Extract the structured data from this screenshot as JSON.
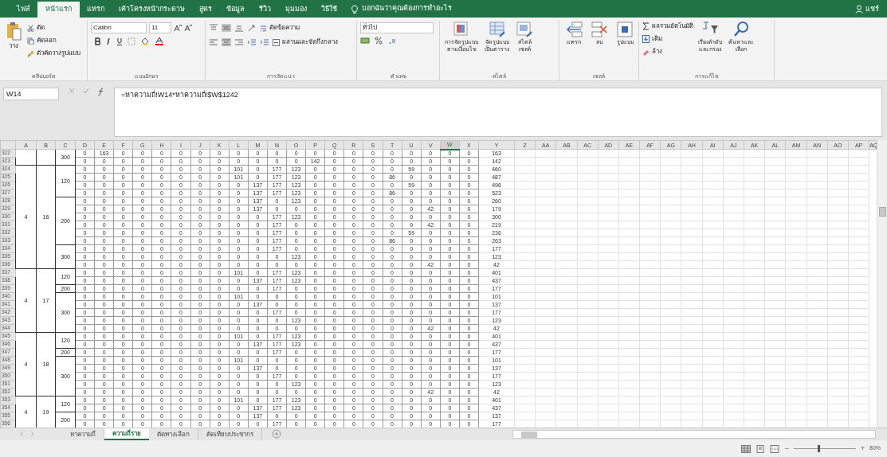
{
  "title_bar": {
    "tabs": [
      {
        "label": "ไฟล์",
        "selected": false
      },
      {
        "label": "หน้าแรก",
        "selected": true
      },
      {
        "label": "แทรก",
        "selected": false
      },
      {
        "label": "เค้าโครงหน้ากระดาษ",
        "selected": false
      },
      {
        "label": "สูตร",
        "selected": false
      },
      {
        "label": "ข้อมูล",
        "selected": false
      },
      {
        "label": "รีวิว",
        "selected": false
      },
      {
        "label": "มุมมอง",
        "selected": false
      },
      {
        "label": "วิธีใช้",
        "selected": false
      }
    ],
    "tell_me": "บอกฉันว่าคุณต้องการทำอะไร",
    "share": "แชร์"
  },
  "ribbon": {
    "clipboard": {
      "paste": "วาง",
      "cut": "ตัด",
      "copy": "คัดลอก",
      "format_painter": "ตัวคัดวางรูปแบบ",
      "label": "คลิปบอร์ด"
    },
    "font": {
      "font_name": "Calibri",
      "font_size": "11",
      "label": "แบบอักษร"
    },
    "alignment": {
      "wrap_text": "ตัดข้อความ",
      "merge_center": "ผสานและจัดกึ่งกลาง",
      "label": "การจัดแนว"
    },
    "number": {
      "format": "ทั่วไป",
      "label": "ตัวเลข"
    },
    "styles": {
      "buttons": [
        [
          "การจัดรูปแบบ",
          "ตามเงื่อนไข"
        ],
        [
          "จัดรูปแบบ",
          "เป็นตาราง"
        ],
        [
          "สไตล์",
          "เซลล์"
        ]
      ],
      "label": "สไตล์"
    },
    "cells": {
      "buttons": [
        "แทรก",
        "ลบ",
        "รูปแบบ"
      ],
      "label": "เซลล์"
    },
    "editing": {
      "autosum": "ผลรวมอัตโนมัติ",
      "fill": "เติม",
      "clear": "ล้าง",
      "sort_filter": [
        "เรียงลำดับ",
        "และกรอง"
      ],
      "find_select": [
        "ค้นหาและ",
        "เลือก"
      ],
      "label": "การแก้ไข"
    }
  },
  "formula_bar": {
    "name_box": "W14",
    "formula": "=หาความถี่!W14*หาความถี่!$W$1242"
  },
  "sheet": {
    "columns": [
      {
        "label": "A",
        "selected": false
      },
      {
        "label": "B",
        "selected": false
      },
      {
        "label": "C",
        "selected": false
      },
      {
        "label": "D",
        "selected": false
      },
      {
        "label": "E",
        "selected": false
      },
      {
        "label": "F",
        "selected": false
      },
      {
        "label": "G",
        "selected": false
      },
      {
        "label": "H",
        "selected": false
      },
      {
        "label": "I",
        "selected": false
      },
      {
        "label": "J",
        "selected": false
      },
      {
        "label": "K",
        "selected": false
      },
      {
        "label": "L",
        "selected": false
      },
      {
        "label": "M",
        "selected": false
      },
      {
        "label": "N",
        "selected": false
      },
      {
        "label": "O",
        "selected": false
      },
      {
        "label": "P",
        "selected": false
      },
      {
        "label": "Q",
        "selected": false
      },
      {
        "label": "R",
        "selected": false
      },
      {
        "label": "S",
        "selected": false
      },
      {
        "label": "T",
        "selected": false
      },
      {
        "label": "U",
        "selected": false
      },
      {
        "label": "V",
        "selected": false
      },
      {
        "label": "W",
        "selected": true
      },
      {
        "label": "X",
        "selected": false
      },
      {
        "label": "Y",
        "selected": false
      },
      {
        "label": "Z",
        "selected": false
      },
      {
        "label": "AA",
        "selected": false
      },
      {
        "label": "AB",
        "selected": false
      },
      {
        "label": "AC",
        "selected": false
      },
      {
        "label": "AD",
        "selected": false
      },
      {
        "label": "AE",
        "selected": false
      },
      {
        "label": "AF",
        "selected": false
      },
      {
        "label": "AG",
        "selected": false
      },
      {
        "label": "AH",
        "selected": false
      },
      {
        "label": "AI",
        "selected": false
      },
      {
        "label": "AJ",
        "selected": false
      },
      {
        "label": "AK",
        "selected": false
      },
      {
        "label": "AL",
        "selected": false
      },
      {
        "label": "AM",
        "selected": false
      },
      {
        "label": "AN",
        "selected": false
      },
      {
        "label": "AO",
        "selected": false
      },
      {
        "label": "AP",
        "selected": false
      },
      {
        "label": "AQ",
        "selected": false
      }
    ],
    "blocks": [
      {
        "subgroups": [
          {
            "column_c": "300",
            "rows": [
              {
                "header": "322",
                "values": [
                  "0",
                  "163",
                  "0",
                  "0",
                  "0",
                  "0",
                  "0",
                  "0",
                  "0",
                  "0",
                  "0",
                  "0",
                  "0",
                  "0",
                  "0",
                  "0",
                  "0",
                  "0",
                  "0",
                  "0",
                  "0"
                ],
                "total": "163"
              },
              {
                "header": "323",
                "values": [
                  "0",
                  "0",
                  "0",
                  "0",
                  "0",
                  "0",
                  "0",
                  "0",
                  "0",
                  "0",
                  "0",
                  "0",
                  "142",
                  "0",
                  "0",
                  "0",
                  "0",
                  "0",
                  "0",
                  "0",
                  "0"
                ],
                "total": "142"
              }
            ]
          }
        ]
      },
      {
        "column_a": "4",
        "column_b": "16",
        "subgroups": [
          {
            "column_c": "120",
            "rows": [
              {
                "header": "324",
                "values": [
                  "0",
                  "0",
                  "0",
                  "0",
                  "0",
                  "0",
                  "0",
                  "0",
                  "101",
                  "0",
                  "177",
                  "123",
                  "0",
                  "0",
                  "0",
                  "0",
                  "0",
                  "59",
                  "0",
                  "0",
                  "0"
                ],
                "total": "460"
              },
              {
                "header": "325",
                "values": [
                  "0",
                  "0",
                  "0",
                  "0",
                  "0",
                  "0",
                  "0",
                  "0",
                  "101",
                  "0",
                  "177",
                  "123",
                  "0",
                  "0",
                  "0",
                  "0",
                  "86",
                  "0",
                  "0",
                  "0",
                  "0"
                ],
                "total": "487"
              },
              {
                "header": "326",
                "values": [
                  "0",
                  "0",
                  "0",
                  "0",
                  "0",
                  "0",
                  "0",
                  "0",
                  "0",
                  "137",
                  "177",
                  "123",
                  "0",
                  "0",
                  "0",
                  "0",
                  "0",
                  "59",
                  "0",
                  "0",
                  "0"
                ],
                "total": "496"
              },
              {
                "header": "327",
                "values": [
                  "0",
                  "0",
                  "0",
                  "0",
                  "0",
                  "0",
                  "0",
                  "0",
                  "0",
                  "137",
                  "177",
                  "123",
                  "0",
                  "0",
                  "0",
                  "0",
                  "86",
                  "0",
                  "0",
                  "0",
                  "0"
                ],
                "total": "523"
              }
            ]
          },
          {
            "column_c": "200",
            "rows": [
              {
                "header": "328",
                "values": [
                  "0",
                  "0",
                  "0",
                  "0",
                  "0",
                  "0",
                  "0",
                  "0",
                  "0",
                  "137",
                  "0",
                  "123",
                  "0",
                  "0",
                  "0",
                  "0",
                  "0",
                  "0",
                  "0",
                  "0",
                  "0"
                ],
                "total": "260"
              },
              {
                "header": "329",
                "values": [
                  "0",
                  "0",
                  "0",
                  "0",
                  "0",
                  "0",
                  "0",
                  "0",
                  "0",
                  "137",
                  "0",
                  "0",
                  "0",
                  "0",
                  "0",
                  "0",
                  "0",
                  "0",
                  "42",
                  "0",
                  "0"
                ],
                "total": "179"
              },
              {
                "header": "330",
                "values": [
                  "0",
                  "0",
                  "0",
                  "0",
                  "0",
                  "0",
                  "0",
                  "0",
                  "0",
                  "0",
                  "177",
                  "123",
                  "0",
                  "0",
                  "0",
                  "0",
                  "0",
                  "0",
                  "0",
                  "0",
                  "0"
                ],
                "total": "300"
              },
              {
                "header": "331",
                "values": [
                  "0",
                  "0",
                  "0",
                  "0",
                  "0",
                  "0",
                  "0",
                  "0",
                  "0",
                  "0",
                  "177",
                  "0",
                  "0",
                  "0",
                  "0",
                  "0",
                  "0",
                  "0",
                  "42",
                  "0",
                  "0"
                ],
                "total": "219"
              },
              {
                "header": "332",
                "values": [
                  "0",
                  "0",
                  "0",
                  "0",
                  "0",
                  "0",
                  "0",
                  "0",
                  "0",
                  "0",
                  "177",
                  "0",
                  "0",
                  "0",
                  "0",
                  "0",
                  "0",
                  "59",
                  "0",
                  "0",
                  "0"
                ],
                "total": "236"
              },
              {
                "header": "333",
                "values": [
                  "0",
                  "0",
                  "0",
                  "0",
                  "0",
                  "0",
                  "0",
                  "0",
                  "0",
                  "0",
                  "177",
                  "0",
                  "0",
                  "0",
                  "0",
                  "0",
                  "86",
                  "0",
                  "0",
                  "0",
                  "0"
                ],
                "total": "263"
              }
            ]
          },
          {
            "column_c": "300",
            "rows": [
              {
                "header": "334",
                "values": [
                  "0",
                  "0",
                  "0",
                  "0",
                  "0",
                  "0",
                  "0",
                  "0",
                  "0",
                  "0",
                  "177",
                  "0",
                  "0",
                  "0",
                  "0",
                  "0",
                  "0",
                  "0",
                  "0",
                  "0",
                  "0"
                ],
                "total": "177"
              },
              {
                "header": "335",
                "values": [
                  "0",
                  "0",
                  "0",
                  "0",
                  "0",
                  "0",
                  "0",
                  "0",
                  "0",
                  "0",
                  "0",
                  "123",
                  "0",
                  "0",
                  "0",
                  "0",
                  "0",
                  "0",
                  "0",
                  "0",
                  "0"
                ],
                "total": "123"
              },
              {
                "header": "336",
                "values": [
                  "0",
                  "0",
                  "0",
                  "0",
                  "0",
                  "0",
                  "0",
                  "0",
                  "0",
                  "0",
                  "0",
                  "0",
                  "0",
                  "0",
                  "0",
                  "0",
                  "0",
                  "0",
                  "42",
                  "0",
                  "0"
                ],
                "total": "42"
              }
            ]
          }
        ]
      },
      {
        "column_a": "4",
        "column_b": "17",
        "subgroups": [
          {
            "column_c": "120",
            "rows": [
              {
                "header": "337",
                "values": [
                  "0",
                  "0",
                  "0",
                  "0",
                  "0",
                  "0",
                  "0",
                  "0",
                  "101",
                  "0",
                  "177",
                  "123",
                  "0",
                  "0",
                  "0",
                  "0",
                  "0",
                  "0",
                  "0",
                  "0",
                  "0"
                ],
                "total": "401"
              },
              {
                "header": "338",
                "values": [
                  "0",
                  "0",
                  "0",
                  "0",
                  "0",
                  "0",
                  "0",
                  "0",
                  "0",
                  "137",
                  "177",
                  "123",
                  "0",
                  "0",
                  "0",
                  "0",
                  "0",
                  "0",
                  "0",
                  "0",
                  "0"
                ],
                "total": "437"
              }
            ]
          },
          {
            "column_c": "200",
            "rows": [
              {
                "header": "339",
                "values": [
                  "0",
                  "0",
                  "0",
                  "0",
                  "0",
                  "0",
                  "0",
                  "0",
                  "0",
                  "0",
                  "177",
                  "0",
                  "0",
                  "0",
                  "0",
                  "0",
                  "0",
                  "0",
                  "0",
                  "0",
                  "0"
                ],
                "total": "177"
              }
            ]
          },
          {
            "column_c": "300",
            "rows": [
              {
                "header": "340",
                "values": [
                  "0",
                  "0",
                  "0",
                  "0",
                  "0",
                  "0",
                  "0",
                  "0",
                  "101",
                  "0",
                  "0",
                  "0",
                  "0",
                  "0",
                  "0",
                  "0",
                  "0",
                  "0",
                  "0",
                  "0",
                  "0"
                ],
                "total": "101"
              },
              {
                "header": "341",
                "values": [
                  "0",
                  "0",
                  "0",
                  "0",
                  "0",
                  "0",
                  "0",
                  "0",
                  "0",
                  "137",
                  "0",
                  "0",
                  "0",
                  "0",
                  "0",
                  "0",
                  "0",
                  "0",
                  "0",
                  "0",
                  "0"
                ],
                "total": "137"
              },
              {
                "header": "342",
                "values": [
                  "0",
                  "0",
                  "0",
                  "0",
                  "0",
                  "0",
                  "0",
                  "0",
                  "0",
                  "0",
                  "177",
                  "0",
                  "0",
                  "0",
                  "0",
                  "0",
                  "0",
                  "0",
                  "0",
                  "0",
                  "0"
                ],
                "total": "177"
              },
              {
                "header": "343",
                "values": [
                  "0",
                  "0",
                  "0",
                  "0",
                  "0",
                  "0",
                  "0",
                  "0",
                  "0",
                  "0",
                  "0",
                  "123",
                  "0",
                  "0",
                  "0",
                  "0",
                  "0",
                  "0",
                  "0",
                  "0",
                  "0"
                ],
                "total": "123"
              },
              {
                "header": "344",
                "values": [
                  "0",
                  "0",
                  "0",
                  "0",
                  "0",
                  "0",
                  "0",
                  "0",
                  "0",
                  "0",
                  "0",
                  "0",
                  "0",
                  "0",
                  "0",
                  "0",
                  "0",
                  "0",
                  "42",
                  "0",
                  "0"
                ],
                "total": "42"
              }
            ]
          }
        ]
      },
      {
        "column_a": "4",
        "column_b": "18",
        "subgroups": [
          {
            "column_c": "120",
            "rows": [
              {
                "header": "345",
                "values": [
                  "0",
                  "0",
                  "0",
                  "0",
                  "0",
                  "0",
                  "0",
                  "0",
                  "101",
                  "0",
                  "177",
                  "123",
                  "0",
                  "0",
                  "0",
                  "0",
                  "0",
                  "0",
                  "0",
                  "0",
                  "0"
                ],
                "total": "401"
              },
              {
                "header": "346",
                "values": [
                  "0",
                  "0",
                  "0",
                  "0",
                  "0",
                  "0",
                  "0",
                  "0",
                  "0",
                  "137",
                  "177",
                  "123",
                  "0",
                  "0",
                  "0",
                  "0",
                  "0",
                  "0",
                  "0",
                  "0",
                  "0"
                ],
                "total": "437"
              }
            ]
          },
          {
            "column_c": "200",
            "rows": [
              {
                "header": "347",
                "values": [
                  "0",
                  "0",
                  "0",
                  "0",
                  "0",
                  "0",
                  "0",
                  "0",
                  "0",
                  "0",
                  "177",
                  "0",
                  "0",
                  "0",
                  "0",
                  "0",
                  "0",
                  "0",
                  "0",
                  "0",
                  "0"
                ],
                "total": "177"
              }
            ]
          },
          {
            "column_c": "300",
            "rows": [
              {
                "header": "348",
                "values": [
                  "0",
                  "0",
                  "0",
                  "0",
                  "0",
                  "0",
                  "0",
                  "0",
                  "101",
                  "0",
                  "0",
                  "0",
                  "0",
                  "0",
                  "0",
                  "0",
                  "0",
                  "0",
                  "0",
                  "0",
                  "0"
                ],
                "total": "101"
              },
              {
                "header": "349",
                "values": [
                  "0",
                  "0",
                  "0",
                  "0",
                  "0",
                  "0",
                  "0",
                  "0",
                  "0",
                  "137",
                  "0",
                  "0",
                  "0",
                  "0",
                  "0",
                  "0",
                  "0",
                  "0",
                  "0",
                  "0",
                  "0"
                ],
                "total": "137"
              },
              {
                "header": "350",
                "values": [
                  "0",
                  "0",
                  "0",
                  "0",
                  "0",
                  "0",
                  "0",
                  "0",
                  "0",
                  "0",
                  "177",
                  "0",
                  "0",
                  "0",
                  "0",
                  "0",
                  "0",
                  "0",
                  "0",
                  "0",
                  "0"
                ],
                "total": "177"
              },
              {
                "header": "351",
                "values": [
                  "0",
                  "0",
                  "0",
                  "0",
                  "0",
                  "0",
                  "0",
                  "0",
                  "0",
                  "0",
                  "0",
                  "123",
                  "0",
                  "0",
                  "0",
                  "0",
                  "0",
                  "0",
                  "0",
                  "0",
                  "0"
                ],
                "total": "123"
              },
              {
                "header": "352",
                "values": [
                  "0",
                  "0",
                  "0",
                  "0",
                  "0",
                  "0",
                  "0",
                  "0",
                  "0",
                  "0",
                  "0",
                  "0",
                  "0",
                  "0",
                  "0",
                  "0",
                  "0",
                  "0",
                  "42",
                  "0",
                  "0"
                ],
                "total": "42"
              }
            ]
          }
        ]
      },
      {
        "column_a": "4",
        "column_b": "19",
        "subgroups": [
          {
            "column_c": "120",
            "rows": [
              {
                "header": "353",
                "values": [
                  "0",
                  "0",
                  "0",
                  "0",
                  "0",
                  "0",
                  "0",
                  "0",
                  "101",
                  "0",
                  "177",
                  "123",
                  "0",
                  "0",
                  "0",
                  "0",
                  "0",
                  "0",
                  "0",
                  "0",
                  "0"
                ],
                "total": "401"
              },
              {
                "header": "354",
                "values": [
                  "0",
                  "0",
                  "0",
                  "0",
                  "0",
                  "0",
                  "0",
                  "0",
                  "0",
                  "137",
                  "177",
                  "123",
                  "0",
                  "0",
                  "0",
                  "0",
                  "0",
                  "0",
                  "0",
                  "0",
                  "0"
                ],
                "total": "437"
              }
            ]
          },
          {
            "column_c": "200",
            "rows": [
              {
                "header": "355",
                "values": [
                  "0",
                  "0",
                  "0",
                  "0",
                  "0",
                  "0",
                  "0",
                  "0",
                  "0",
                  "137",
                  "0",
                  "0",
                  "0",
                  "0",
                  "0",
                  "0",
                  "0",
                  "0",
                  "0",
                  "0",
                  "0"
                ],
                "total": "137"
              },
              {
                "header": "356",
                "values": [
                  "0",
                  "0",
                  "0",
                  "0",
                  "0",
                  "0",
                  "0",
                  "0",
                  "0",
                  "0",
                  "177",
                  "0",
                  "0",
                  "0",
                  "0",
                  "0",
                  "0",
                  "0",
                  "0",
                  "0",
                  "0"
                ],
                "total": "177"
              }
            ]
          }
        ]
      }
    ]
  },
  "sheet_tabs": [
    {
      "label": "หาความถี่",
      "selected": false
    },
    {
      "label": "ความถี่ราย",
      "selected": true
    },
    {
      "label": "ตัดทางเลือก",
      "selected": false
    },
    {
      "label": "ตัดเทียบประชากร",
      "selected": false
    }
  ],
  "status_bar": {
    "zoom_out": "−",
    "zoom_in": "+",
    "zoom": "80%",
    "zoom_slider": {
      "level": 0.4
    }
  }
}
